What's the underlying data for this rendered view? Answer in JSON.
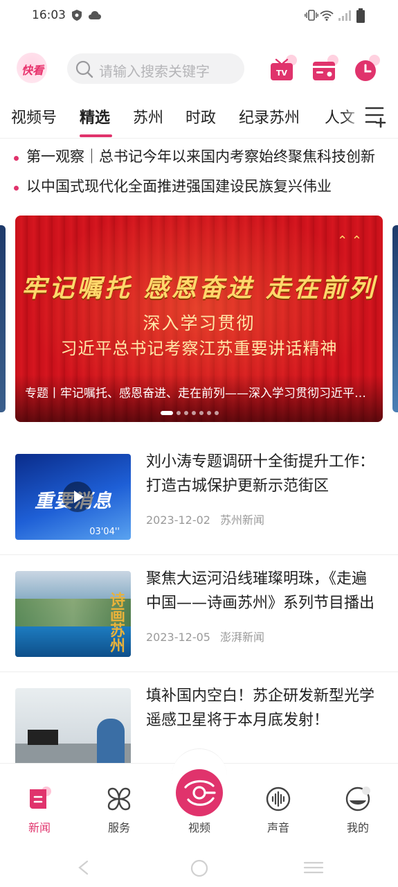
{
  "status_bar": {
    "time": "16:03",
    "icons": [
      "vpn-shield-icon",
      "cloud-icon",
      "vibrate-icon",
      "wifi-icon",
      "signal-icon",
      "battery-icon"
    ]
  },
  "header": {
    "logo_text": "快看",
    "search_placeholder": "请输入搜索关键字",
    "buttons": [
      "tv-icon",
      "radio-icon",
      "history-clock-icon"
    ],
    "accent_color": "#e0336c"
  },
  "tabs": {
    "items": [
      "视频号",
      "精选",
      "苏州",
      "时政",
      "纪录苏州",
      "人文"
    ],
    "active": "精选"
  },
  "headlines": [
    "第一观察｜总书记今年以来国内考察始终聚焦科技创新",
    "以中国式现代化全面推进强国建设民族复兴伟业"
  ],
  "banner": {
    "line1": "牢记嘱托 感恩奋进 走在前列",
    "line2": "深入学习贯彻",
    "line3": "习近平总书记考察江苏重要讲话精神",
    "caption": "专题丨牢记嘱托、感恩奋进、走在前列——深入学习贯彻习近平总书记考察江苏重要讲话精神",
    "slide_count": 7,
    "active_slide": 1
  },
  "news": [
    {
      "title": "刘小涛专题调研十全街提升工作：打造古城保护更新示范街区",
      "date": "2023-12-02",
      "source": "苏州新闻",
      "thumb_text": "重要消息",
      "duration": "03'04''"
    },
    {
      "title": "聚焦大运河沿线璀璨明珠，《走遍中国——诗画苏州》系列节目播出",
      "date": "2023-12-05",
      "source": "澎湃新闻",
      "thumb_text": "诗画苏州"
    },
    {
      "title": "填补国内空白！苏企研发新型光学遥感卫星将于本月底发射！",
      "date": "",
      "source": ""
    }
  ],
  "bottom_nav": {
    "items": [
      {
        "label": "新闻",
        "icon": "news-icon",
        "active": true
      },
      {
        "label": "服务",
        "icon": "services-icon",
        "active": false
      },
      {
        "label": "视频",
        "icon": "video-icon",
        "active": false
      },
      {
        "label": "声音",
        "icon": "audio-icon",
        "active": false
      },
      {
        "label": "我的",
        "icon": "profile-icon",
        "active": false
      }
    ]
  }
}
